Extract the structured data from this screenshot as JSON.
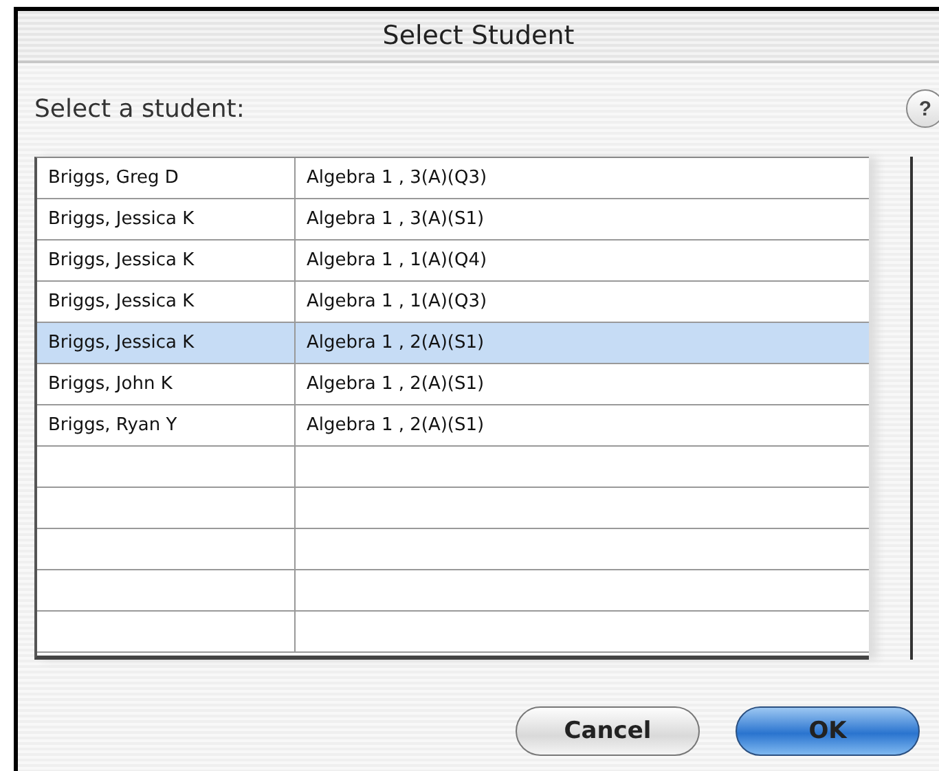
{
  "window": {
    "title": "Select Student"
  },
  "prompt": "Select a student:",
  "help_button": {
    "label": "?"
  },
  "table": {
    "rows": [
      {
        "student": "Briggs, Greg D",
        "course": "Algebra 1 , 3(A)(Q3)",
        "selected": false
      },
      {
        "student": "Briggs, Jessica K",
        "course": "Algebra 1 , 3(A)(S1)",
        "selected": false
      },
      {
        "student": "Briggs, Jessica K",
        "course": "Algebra 1 , 1(A)(Q4)",
        "selected": false
      },
      {
        "student": "Briggs, Jessica K",
        "course": "Algebra 1 , 1(A)(Q3)",
        "selected": false
      },
      {
        "student": "Briggs, Jessica K",
        "course": "Algebra 1 , 2(A)(S1)",
        "selected": true
      },
      {
        "student": "Briggs, John K",
        "course": "Algebra 1 , 2(A)(S1)",
        "selected": false
      },
      {
        "student": "Briggs, Ryan Y",
        "course": "Algebra 1 , 2(A)(S1)",
        "selected": false
      },
      {
        "selected": false
      },
      {
        "selected": false
      },
      {
        "selected": false
      },
      {
        "selected": false
      },
      {
        "selected": false
      }
    ]
  },
  "buttons": [
    {
      "label": "Cancel",
      "kind": "normal"
    },
    {
      "label": "OK",
      "kind": "default"
    }
  ]
}
